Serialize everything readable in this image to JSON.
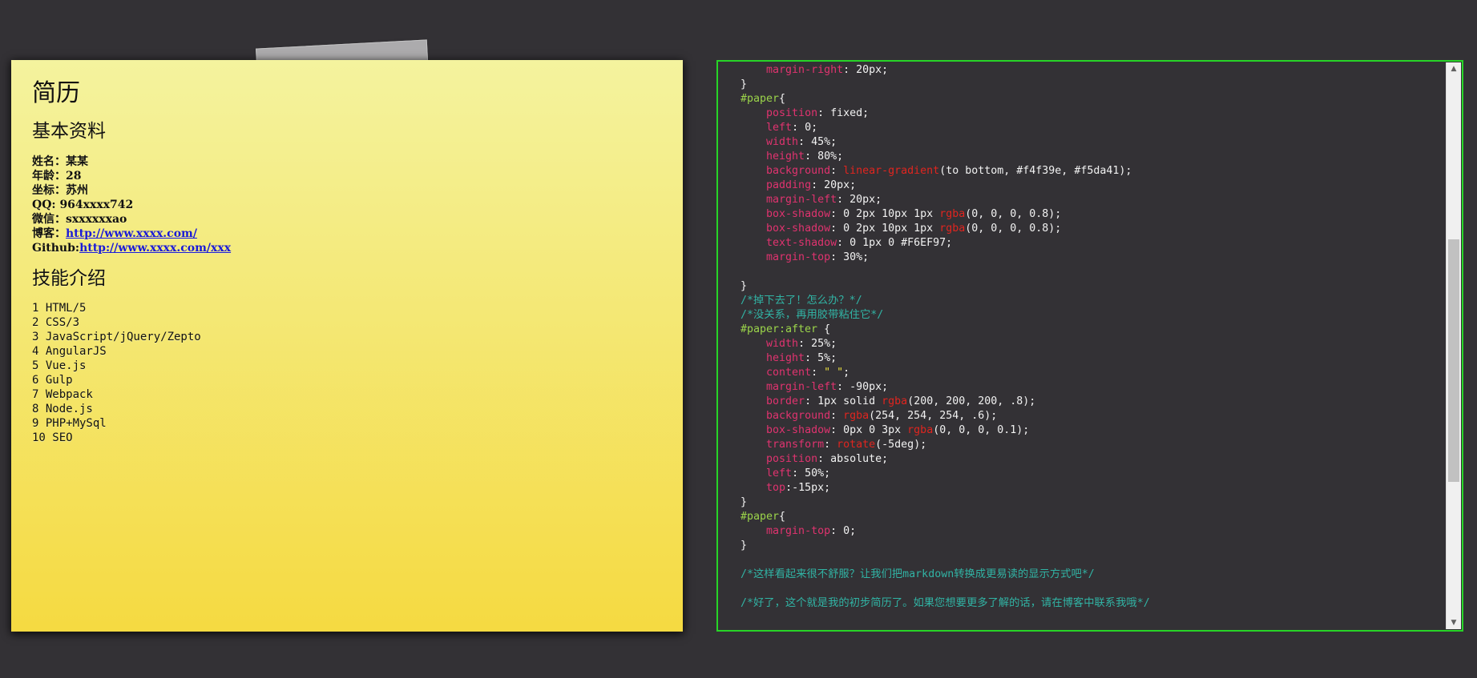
{
  "resume": {
    "title": "简历",
    "basic_heading": "基本资料",
    "info": [
      {
        "label": "姓名：",
        "value": "某某"
      },
      {
        "label": "年龄：",
        "value": "28"
      },
      {
        "label": "坐标：",
        "value": "苏州"
      },
      {
        "label": "QQ: ",
        "value": "964xxxx742"
      },
      {
        "label": "微信：",
        "value": "sxxxxxxao"
      }
    ],
    "blog": {
      "label": "博客：",
      "link": "http://www.xxxx.com/"
    },
    "github": {
      "label": "Github:",
      "link": "http://www.xxxx.com/xxx"
    },
    "skills_heading": "技能介绍",
    "skills": [
      "1 HTML/5",
      "2 CSS/3",
      "3 JavaScript/jQuery/Zepto",
      "4 AngularJS",
      "5 Vue.js",
      "6 Gulp",
      "7 Webpack",
      "8 Node.js",
      "9 PHP+MySql",
      "10 SEO"
    ]
  },
  "code_lines": [
    [
      [
        "    ",
        ""
      ],
      [
        "margin-right",
        "prop"
      ],
      [
        ": 20px;",
        ""
      ]
    ],
    [
      [
        "}",
        ""
      ]
    ],
    [
      [
        "#paper",
        "sel"
      ],
      [
        "{",
        ""
      ]
    ],
    [
      [
        "    ",
        ""
      ],
      [
        "position",
        "prop"
      ],
      [
        ": fixed;",
        ""
      ]
    ],
    [
      [
        "    ",
        ""
      ],
      [
        "left",
        "prop"
      ],
      [
        ": 0;",
        ""
      ]
    ],
    [
      [
        "    ",
        ""
      ],
      [
        "width",
        "prop"
      ],
      [
        ": 45%;",
        ""
      ]
    ],
    [
      [
        "    ",
        ""
      ],
      [
        "height",
        "prop"
      ],
      [
        ": 80%;",
        ""
      ]
    ],
    [
      [
        "    ",
        ""
      ],
      [
        "background",
        "prop"
      ],
      [
        ": ",
        ""
      ],
      [
        "linear-gradient",
        "fn"
      ],
      [
        "(to bottom, #f4f39e, #f5da41);",
        ""
      ]
    ],
    [
      [
        "    ",
        ""
      ],
      [
        "padding",
        "prop"
      ],
      [
        ": 20px;",
        ""
      ]
    ],
    [
      [
        "    ",
        ""
      ],
      [
        "margin-left",
        "prop"
      ],
      [
        ": 20px;",
        ""
      ]
    ],
    [
      [
        "    ",
        ""
      ],
      [
        "box-shadow",
        "prop"
      ],
      [
        ": 0 2px 10px 1px ",
        ""
      ],
      [
        "rgba",
        "fn"
      ],
      [
        "(0, 0, 0, 0.8);",
        ""
      ]
    ],
    [
      [
        "    ",
        ""
      ],
      [
        "box-shadow",
        "prop"
      ],
      [
        ": 0 2px 10px 1px ",
        ""
      ],
      [
        "rgba",
        "fn"
      ],
      [
        "(0, 0, 0, 0.8);",
        ""
      ]
    ],
    [
      [
        "    ",
        ""
      ],
      [
        "text-shadow",
        "prop"
      ],
      [
        ": 0 1px 0 #F6EF97;",
        ""
      ]
    ],
    [
      [
        "    ",
        ""
      ],
      [
        "margin-top",
        "prop"
      ],
      [
        ": 30%;",
        ""
      ]
    ],
    [
      [
        "",
        ""
      ]
    ],
    [
      [
        "}",
        ""
      ]
    ],
    [
      [
        "/*掉下去了！怎么办？*/",
        "cmt"
      ]
    ],
    [
      [
        "/*没关系，再用胶带粘住它*/",
        "cmt"
      ]
    ],
    [
      [
        "#paper:after",
        "sel"
      ],
      [
        " {",
        ""
      ]
    ],
    [
      [
        "    ",
        ""
      ],
      [
        "width",
        "prop"
      ],
      [
        ": 25%;",
        ""
      ]
    ],
    [
      [
        "    ",
        ""
      ],
      [
        "height",
        "prop"
      ],
      [
        ": 5%;",
        ""
      ]
    ],
    [
      [
        "    ",
        ""
      ],
      [
        "content",
        "prop"
      ],
      [
        ": ",
        ""
      ],
      [
        "\" \"",
        "str"
      ],
      [
        ";",
        ""
      ]
    ],
    [
      [
        "    ",
        ""
      ],
      [
        "margin-left",
        "prop"
      ],
      [
        ": -90px;",
        ""
      ]
    ],
    [
      [
        "    ",
        ""
      ],
      [
        "border",
        "prop"
      ],
      [
        ": 1px solid ",
        ""
      ],
      [
        "rgba",
        "fn"
      ],
      [
        "(200, 200, 200, .8);",
        ""
      ]
    ],
    [
      [
        "    ",
        ""
      ],
      [
        "background",
        "prop"
      ],
      [
        ": ",
        ""
      ],
      [
        "rgba",
        "fn"
      ],
      [
        "(254, 254, 254, .6);",
        ""
      ]
    ],
    [
      [
        "    ",
        ""
      ],
      [
        "box-shadow",
        "prop"
      ],
      [
        ": 0px 0 3px ",
        ""
      ],
      [
        "rgba",
        "fn"
      ],
      [
        "(0, 0, 0, 0.1);",
        ""
      ]
    ],
    [
      [
        "    ",
        ""
      ],
      [
        "transform",
        "prop"
      ],
      [
        ": ",
        ""
      ],
      [
        "rotate",
        "fn"
      ],
      [
        "(-5deg);",
        ""
      ]
    ],
    [
      [
        "    ",
        ""
      ],
      [
        "position",
        "prop"
      ],
      [
        ": absolute;",
        ""
      ]
    ],
    [
      [
        "    ",
        ""
      ],
      [
        "left",
        "prop"
      ],
      [
        ": 50%;",
        ""
      ]
    ],
    [
      [
        "    ",
        ""
      ],
      [
        "top",
        "prop"
      ],
      [
        ":-15px;",
        ""
      ]
    ],
    [
      [
        "}",
        ""
      ]
    ],
    [
      [
        "#paper",
        "sel"
      ],
      [
        "{",
        ""
      ]
    ],
    [
      [
        "    ",
        ""
      ],
      [
        "margin-top",
        "prop"
      ],
      [
        ": 0;",
        ""
      ]
    ],
    [
      [
        "}",
        ""
      ]
    ],
    [
      [
        "",
        ""
      ]
    ],
    [
      [
        "/*这样看起来很不舒服？让我们把markdown转换成更易读的显示方式吧*/",
        "cmt"
      ]
    ],
    [
      [
        "",
        ""
      ]
    ],
    [
      [
        "/*好了，这个就是我的初步简历了。如果您想要更多了解的话，请在博客中联系我哦*/",
        "cmt"
      ]
    ]
  ],
  "scroll": {
    "up_glyph": "▲",
    "down_glyph": "▼",
    "position_fraction": 0.55,
    "visible_fraction": 0.45
  },
  "colors": {
    "paper_top": "#f4f39e",
    "paper_bottom": "#f5da41",
    "panel_border": "#27d427",
    "background": "#333135"
  }
}
